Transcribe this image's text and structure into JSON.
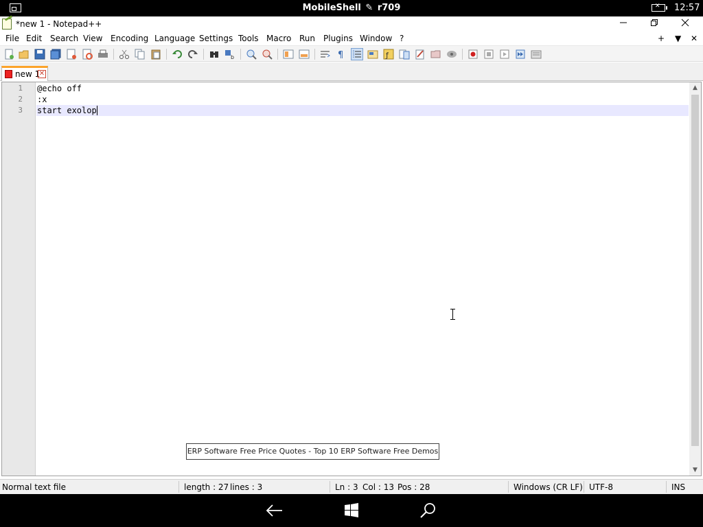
{
  "shell": {
    "title_main": "MobileShell",
    "title_version": "r709",
    "clock": "12:57"
  },
  "window": {
    "title": "*new 1 - Notepad++"
  },
  "menu": {
    "items": [
      "File",
      "Edit",
      "Search",
      "View",
      "Encoding",
      "Language",
      "Settings",
      "Tools",
      "Macro",
      "Run",
      "Plugins",
      "Window",
      "?"
    ],
    "right_controls": [
      "+",
      "▼",
      "✕"
    ]
  },
  "toolbar": {
    "icons": [
      "new-file-icon",
      "open-file-icon",
      "save-icon",
      "save-all-icon",
      "close-icon",
      "close-all-icon",
      "print-icon",
      "cut-icon",
      "copy-icon",
      "paste-icon",
      "undo-icon",
      "redo-icon",
      "find-icon",
      "replace-icon",
      "zoom-in-icon",
      "zoom-out-icon",
      "sync-vertical-icon",
      "sync-horizontal-icon",
      "word-wrap-icon",
      "show-all-chars-icon",
      "indent-guide-icon",
      "user-define-language-icon",
      "function-list-icon",
      "document-map-icon",
      "folder-as-workspace-icon",
      "monitoring-icon",
      "record-macro-icon",
      "stop-recording-icon",
      "playback-macro-icon",
      "run-macro-multiple-icon",
      "save-macro-icon"
    ]
  },
  "tabs": [
    {
      "label": "new 1",
      "active": true,
      "modified": true
    }
  ],
  "editor": {
    "lines": [
      {
        "number": "1",
        "text": "@echo off"
      },
      {
        "number": "2",
        "text": ":x"
      },
      {
        "number": "3",
        "text": "start exolop"
      }
    ],
    "current_line": 3,
    "current_line_color": "#e8e8ff"
  },
  "ad": {
    "text": "ERP Software Free Price Quotes - Top 10 ERP Software Free Demos"
  },
  "status": {
    "file_type": "Normal text file",
    "length": "length : 27",
    "lines": "lines : 3",
    "ln": "Ln : 3",
    "col": "Col : 13",
    "pos": "Pos : 28",
    "eol": "Windows (CR LF)",
    "encoding": "UTF-8",
    "mode": "INS"
  },
  "navbar": {
    "buttons": [
      "back-arrow-icon",
      "windows-start-icon",
      "search-icon"
    ]
  },
  "colors": {
    "tab_accent": "#fca32a",
    "gutter": "#e8e8e8"
  }
}
